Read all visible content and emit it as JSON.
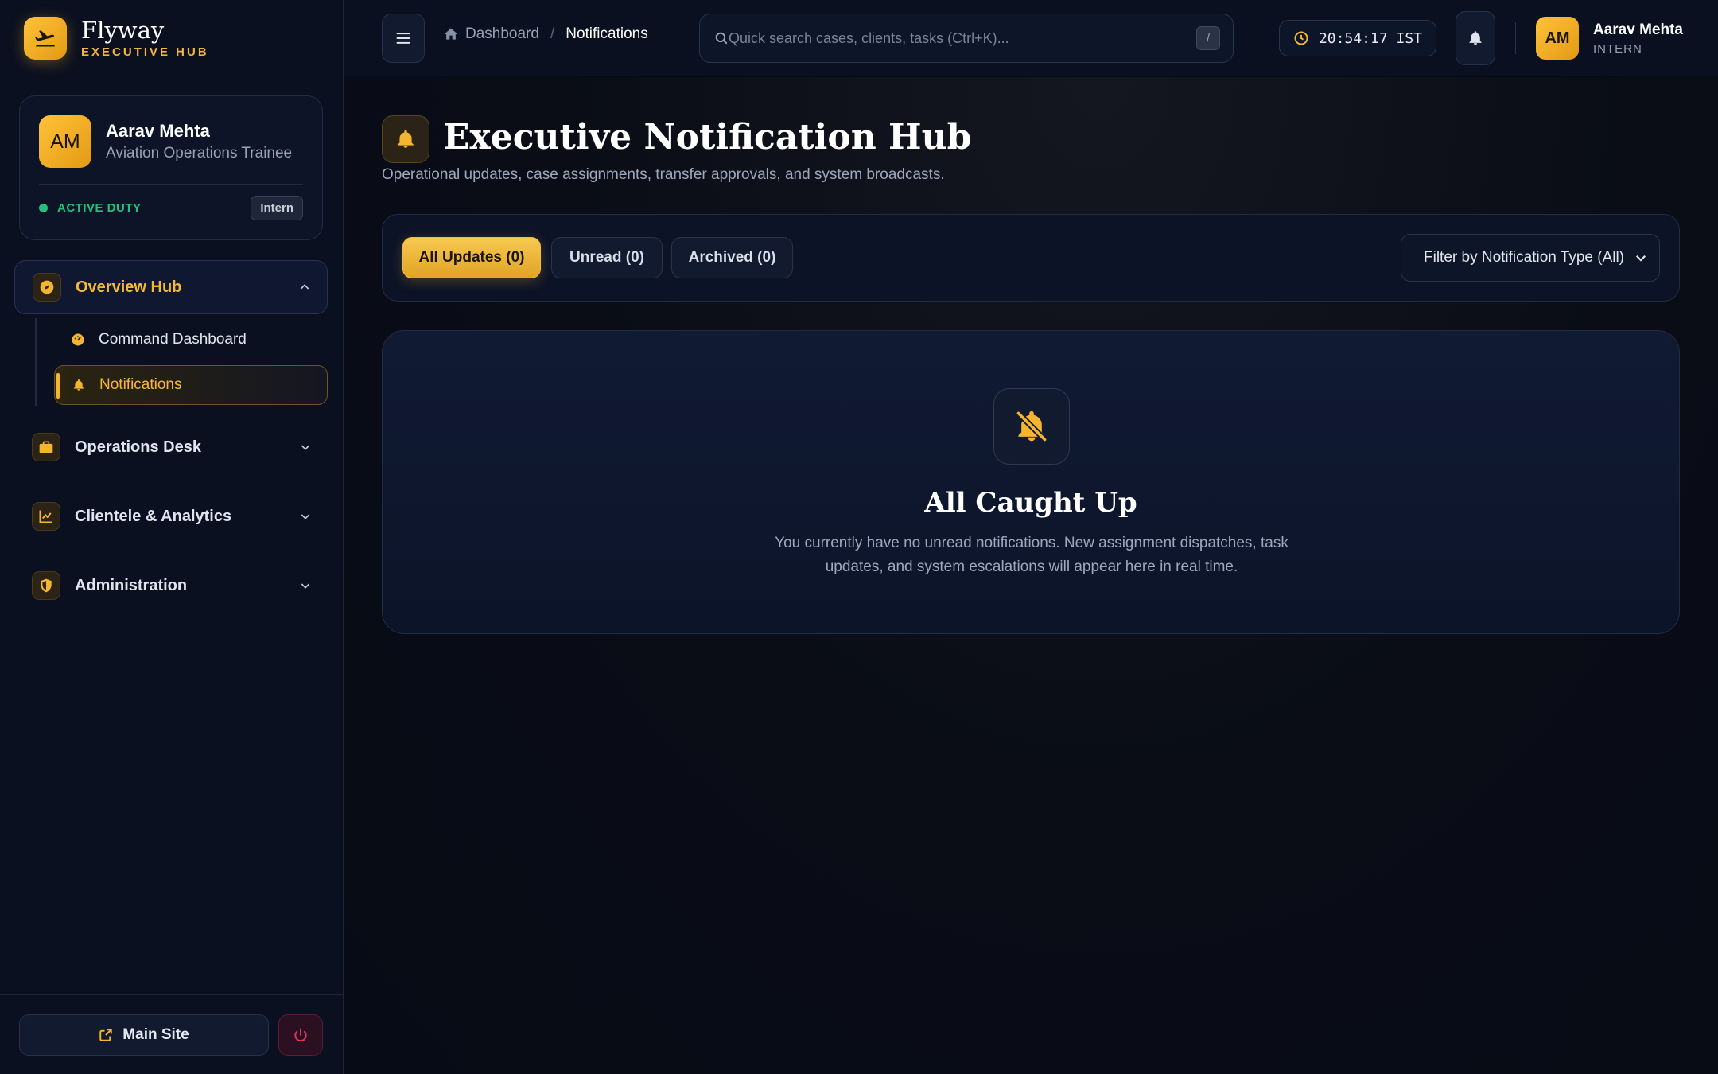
{
  "brand": {
    "name": "Flyway",
    "subtitle": "EXECUTIVE HUB"
  },
  "profile": {
    "initials": "AM",
    "name": "Aarav Mehta",
    "role": "Aviation Operations Trainee",
    "status": "ACTIVE DUTY",
    "badge": "Intern"
  },
  "sidebar": {
    "groups": [
      {
        "label": "Overview Hub",
        "icon": "compass-icon",
        "expanded": true
      },
      {
        "label": "Operations Desk",
        "icon": "briefcase-icon",
        "expanded": false
      },
      {
        "label": "Clientele & Analytics",
        "icon": "chart-line-icon",
        "expanded": false
      },
      {
        "label": "Administration",
        "icon": "shield-icon",
        "expanded": false
      }
    ],
    "overview_items": [
      {
        "label": "Command Dashboard",
        "icon": "gauge-icon"
      },
      {
        "label": "Notifications",
        "icon": "bell-icon",
        "active": true
      }
    ],
    "main_site": "Main Site"
  },
  "topbar": {
    "breadcrumb": {
      "home": "Dashboard",
      "current": "Notifications"
    },
    "search_placeholder": "Quick search cases, clients, tasks (Ctrl+K)...",
    "search_shortcut": "/",
    "clock": "20:54:17 IST",
    "user": {
      "initials": "AM",
      "name": "Aarav Mehta",
      "role": "INTERN"
    }
  },
  "page": {
    "title": "Executive Notification Hub",
    "subtitle": "Operational updates, case assignments, transfer approvals, and system broadcasts."
  },
  "filters": {
    "tabs": [
      "All Updates (0)",
      "Unread (0)",
      "Archived (0)"
    ],
    "active_tab": 0,
    "type_select": "Filter by Notification Type (All)"
  },
  "empty_state": {
    "title": "All Caught Up",
    "text": "You currently have no unread notifications. New assignment dispatches, task updates, and system escalations will appear here in real time."
  },
  "colors": {
    "accent": "#F5B52E",
    "success": "#22C07A",
    "danger": "#E0345F",
    "background": "#070B16"
  }
}
